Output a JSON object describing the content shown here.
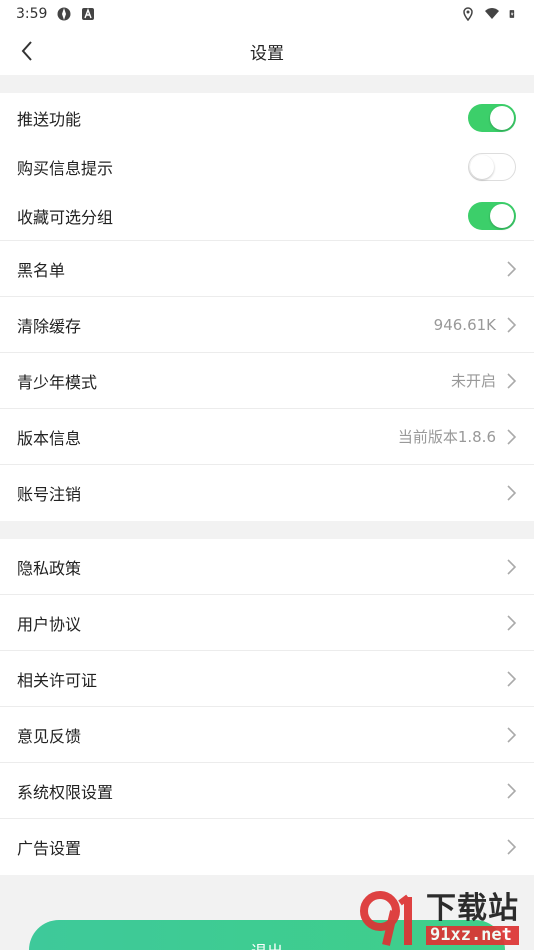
{
  "status_bar": {
    "time": "3:59"
  },
  "header": {
    "title": "设置",
    "back_icon": "chevron-left-icon"
  },
  "toggles": [
    {
      "label": "推送功能",
      "on": true
    },
    {
      "label": "购买信息提示",
      "on": false
    },
    {
      "label": "收藏可选分组",
      "on": true
    }
  ],
  "group1": [
    {
      "label": "黑名单",
      "value": ""
    },
    {
      "label": "清除缓存",
      "value": "946.61K"
    },
    {
      "label": "青少年模式",
      "value": "未开启"
    },
    {
      "label": "版本信息",
      "value": "当前版本1.8.6"
    },
    {
      "label": "账号注销",
      "value": ""
    }
  ],
  "group2": [
    {
      "label": "隐私政策"
    },
    {
      "label": "用户协议"
    },
    {
      "label": "相关许可证"
    },
    {
      "label": "意见反馈"
    },
    {
      "label": "系统权限设置"
    },
    {
      "label": "广告设置"
    }
  ],
  "logout_label": "退出",
  "watermark": {
    "cn": "下载站",
    "url": "91xz.net"
  },
  "colors": {
    "toggle_on": "#3ccf6a",
    "logout": "#3fcf89",
    "watermark_red": "#dd3333"
  }
}
